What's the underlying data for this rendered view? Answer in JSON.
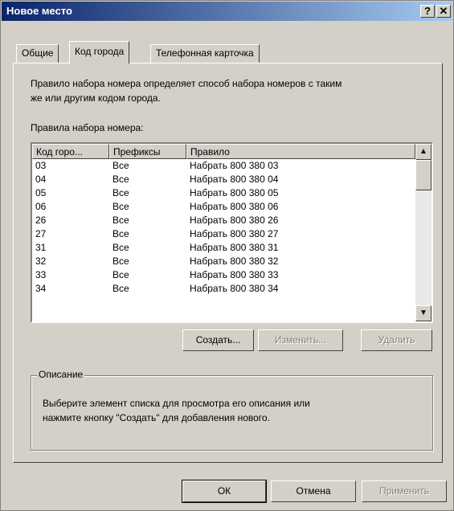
{
  "window": {
    "title": "Новое место",
    "help_glyph": "?",
    "close_glyph": "✕"
  },
  "tabs": [
    {
      "label": "Общие"
    },
    {
      "label": "Код города"
    },
    {
      "label": "Телефонная карточка"
    }
  ],
  "intro_text": [
    "Правило набора номера определяет способ набора номеров с таким",
    "же или другим кодом города."
  ],
  "rules_label": "Правила набора номера:",
  "table": {
    "columns": [
      "Код горо...",
      "Префиксы",
      "Правило"
    ],
    "rows": [
      [
        "03",
        "Все",
        "Набрать 800 380 03"
      ],
      [
        "04",
        "Все",
        "Набрать 800 380 04"
      ],
      [
        "05",
        "Все",
        "Набрать 800 380 05"
      ],
      [
        "06",
        "Все",
        "Набрать 800 380 06"
      ],
      [
        "26",
        "Все",
        "Набрать 800 380 26"
      ],
      [
        "27",
        "Все",
        "Набрать 800 380 27"
      ],
      [
        "31",
        "Все",
        "Набрать 800 380 31"
      ],
      [
        "32",
        "Все",
        "Набрать 800 380 32"
      ],
      [
        "33",
        "Все",
        "Набрать 800 380 33"
      ],
      [
        "34",
        "Все",
        "Набрать 800 380 34"
      ]
    ]
  },
  "list_buttons": {
    "create": "Создать...",
    "edit": "Изменить...",
    "delete": "Удалить"
  },
  "description": {
    "legend": "Описание",
    "lines": [
      "Выберите элемент списка для просмотра его описания или",
      "нажмите кнопку \"Создать\" для добавления нового."
    ]
  },
  "dialog_buttons": {
    "ok": "ОК",
    "cancel": "Отмена",
    "apply": "Применить"
  }
}
